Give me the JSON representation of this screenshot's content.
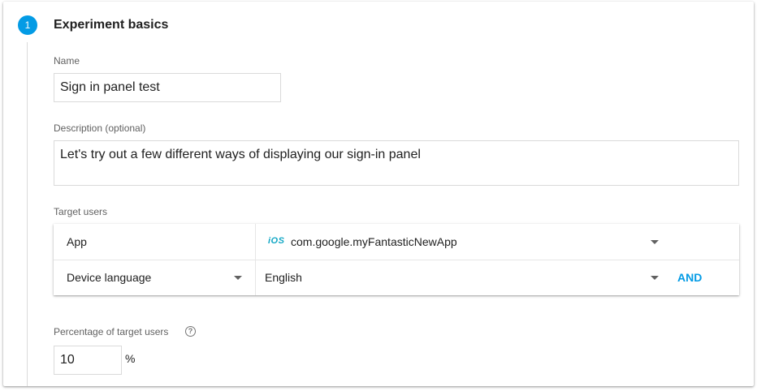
{
  "step": {
    "number": "1",
    "title": "Experiment basics"
  },
  "name_field": {
    "label": "Name",
    "value": "Sign in panel test"
  },
  "description_field": {
    "label": "Description (optional)",
    "value": "Let's try out a few different ways of displaying our sign-in panel"
  },
  "target_users": {
    "label": "Target users",
    "rows": [
      {
        "condition": "App",
        "platform_icon": "iOS",
        "value": "com.google.myFantasticNewApp"
      },
      {
        "condition": "Device language",
        "value": "English",
        "and_label": "AND"
      }
    ]
  },
  "percentage": {
    "label": "Percentage of target users",
    "help_icon": "?",
    "value": "10",
    "unit": "%"
  },
  "colors": {
    "accent": "#039be5",
    "ios_icon": "#12a7c5"
  }
}
